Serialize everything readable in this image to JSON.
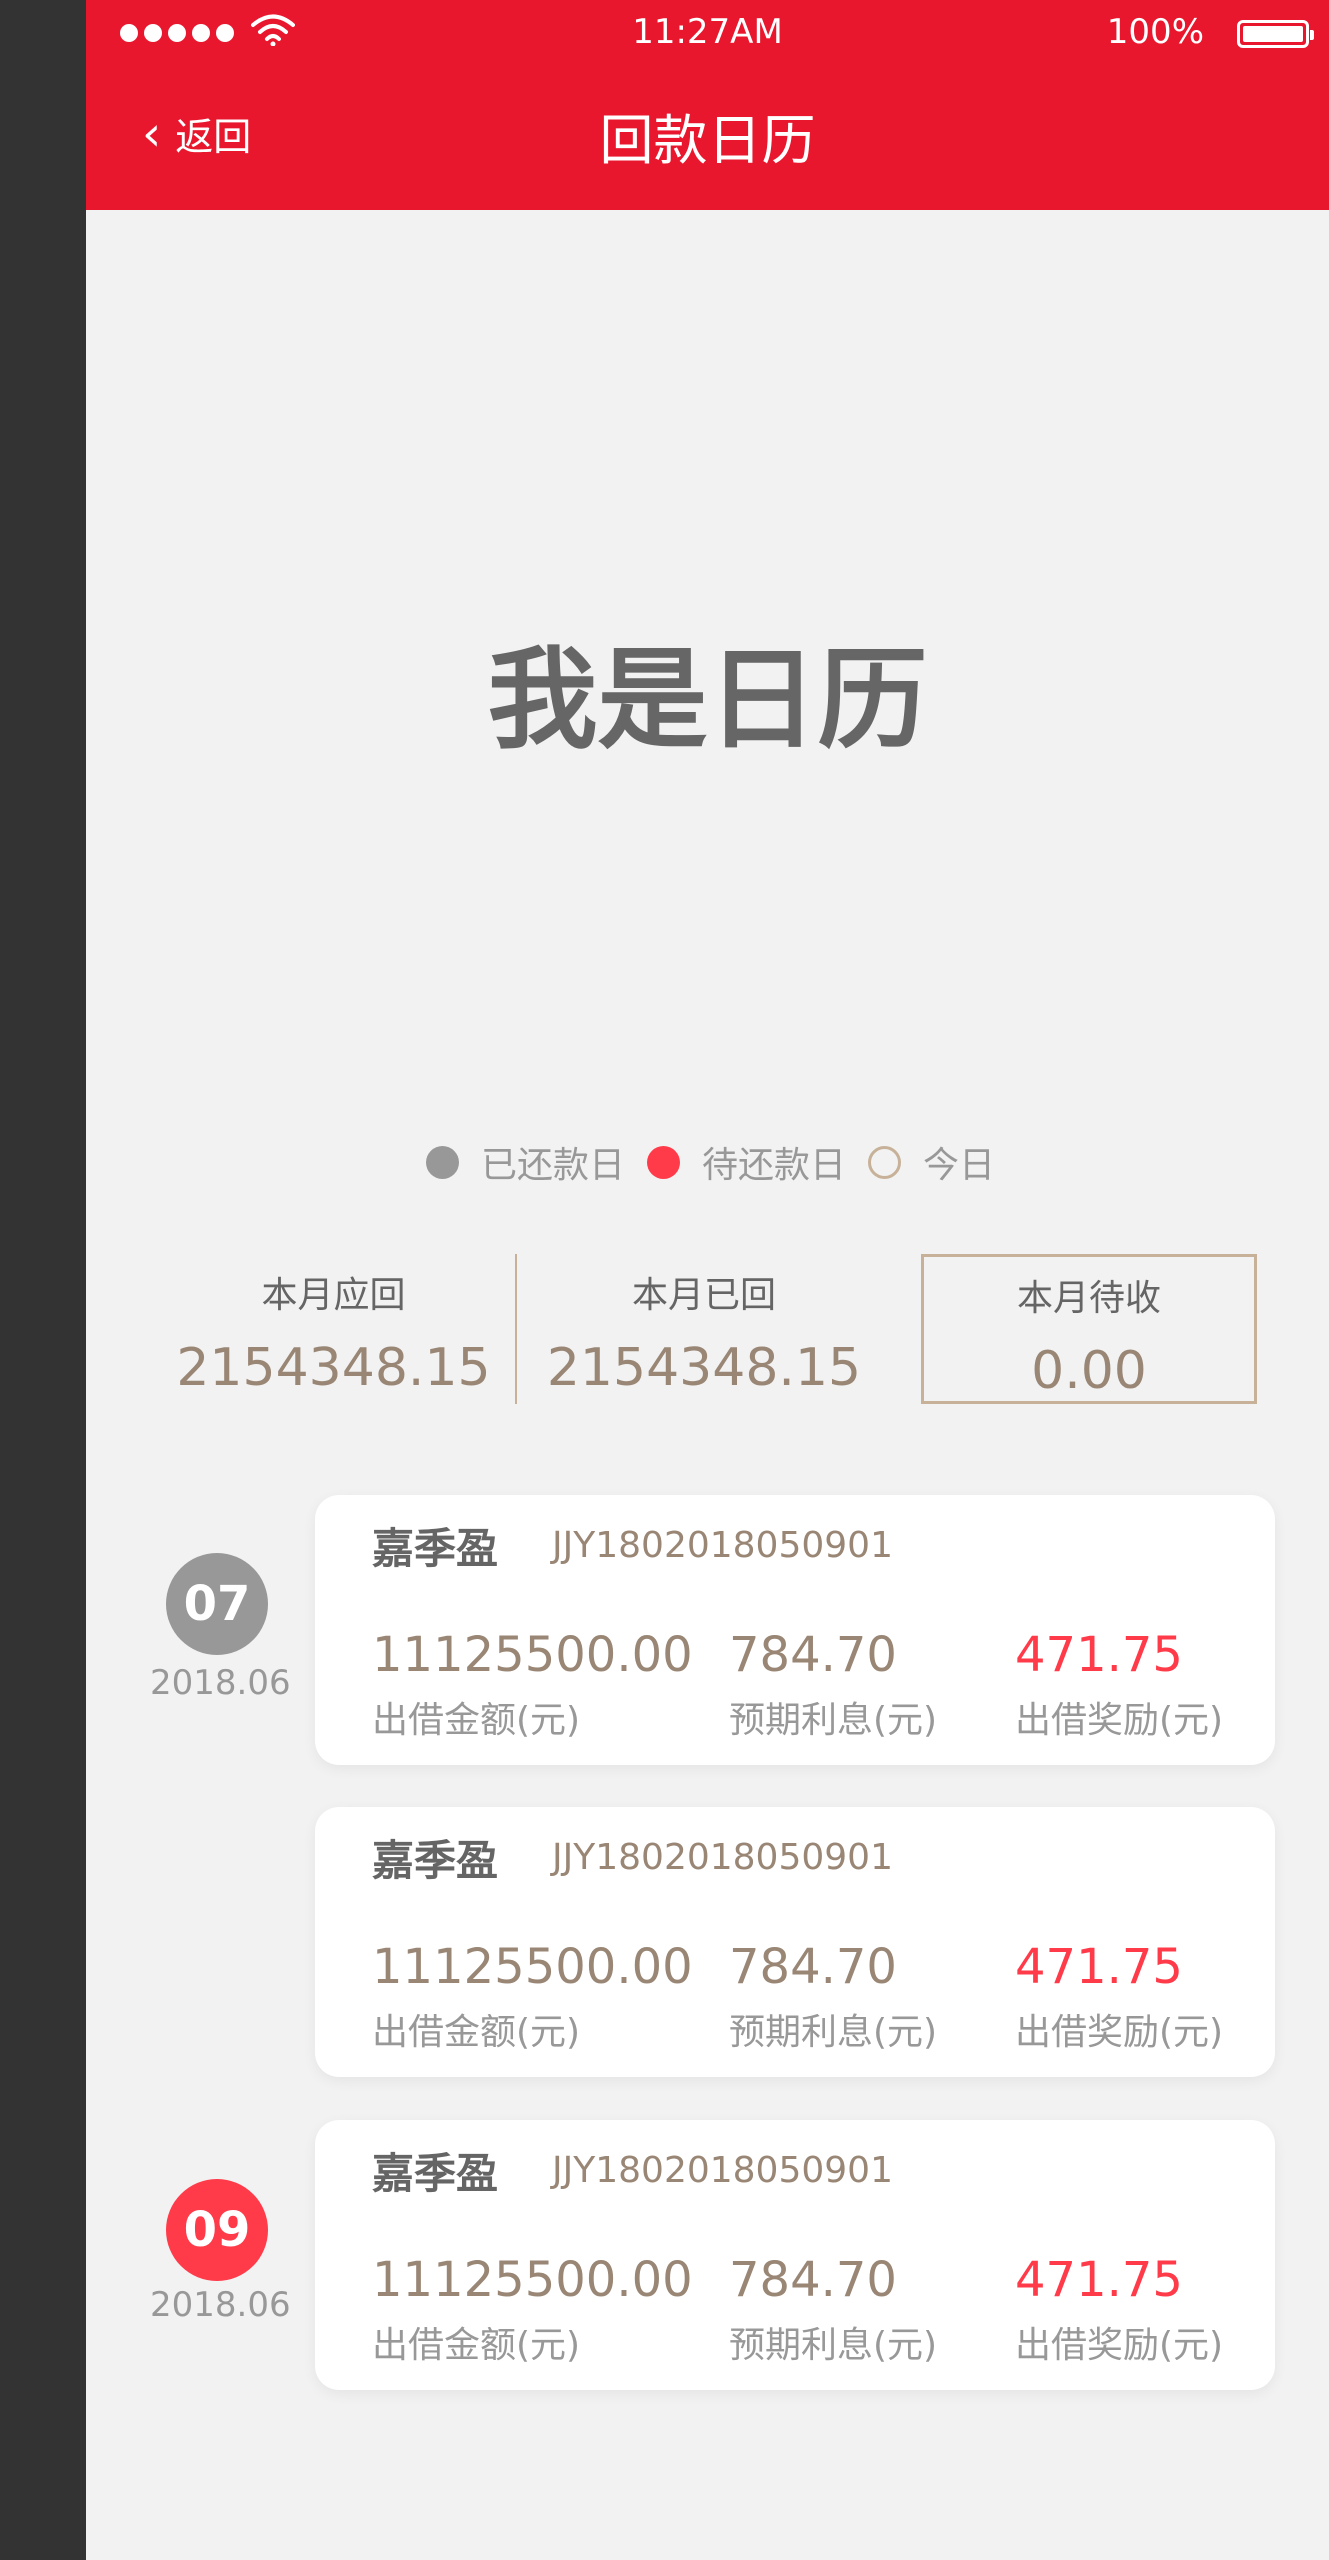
{
  "status_bar": {
    "time": "11:27AM",
    "battery": "100%"
  },
  "header": {
    "back_label": "返回",
    "title": "回款日历"
  },
  "calendar_placeholder": "我是日历",
  "legend": {
    "paid": "已还款日",
    "due": "待还款日",
    "today": "今日"
  },
  "summary": [
    {
      "label": "本月应回",
      "value": "2154348.15"
    },
    {
      "label": "本月已回",
      "value": "2154348.15"
    },
    {
      "label": "本月待收",
      "value": "0.00"
    }
  ],
  "column_labels": {
    "amount": "出借金额(元)",
    "interest": "预期利息(元)",
    "reward": "出借奖励(元)"
  },
  "records": [
    {
      "day": "07",
      "month": "2018.06",
      "cards": [
        {
          "name": "嘉季盈",
          "code": "JJY1802018050901",
          "amount": "11125500.00",
          "interest": "784.70",
          "reward": "471.75"
        },
        {
          "name": "嘉季盈",
          "code": "JJY1802018050901",
          "amount": "11125500.00",
          "interest": "784.70",
          "reward": "471.75"
        }
      ]
    },
    {
      "day": "09",
      "month": "2018.06",
      "cards": [
        {
          "name": "嘉季盈",
          "code": "JJY1802018050901",
          "amount": "11125500.00",
          "interest": "784.70",
          "reward": "471.75"
        }
      ]
    }
  ],
  "colors": {
    "header": "#e8172e",
    "paid": "#989898",
    "due": "#ff3a49",
    "today_border": "#c7b299",
    "value": "#998675",
    "label": "#989898",
    "name": "#656565"
  }
}
